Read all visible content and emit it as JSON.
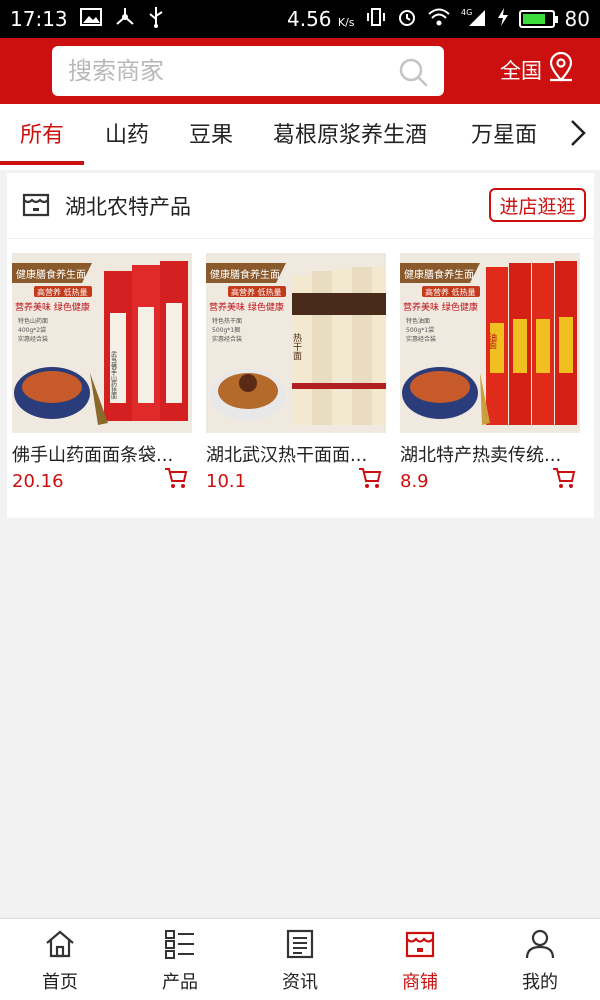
{
  "status_bar": {
    "time": "17:13",
    "net_speed": "4.56",
    "net_unit": "K/s",
    "network": "4G",
    "battery": "80",
    "battery_level": 0.8
  },
  "header": {
    "search_placeholder": "搜索商家",
    "region_label": "全国"
  },
  "tabs": [
    {
      "label": "所有",
      "active": true
    },
    {
      "label": "山药"
    },
    {
      "label": "豆果"
    },
    {
      "label": "葛根原浆养生酒"
    },
    {
      "label": "万星面"
    }
  ],
  "shop": {
    "name": "湖北农特产品",
    "visit_label": "进店逛逛",
    "products": [
      {
        "name": "佛手山药面面条袋...",
        "price": "20.16",
        "banner": "健康膳食养生面",
        "badge": "高营养 低热量",
        "slogan": "营养美味 绿色健康",
        "bullets": [
          "特色山药面",
          "400g*2袋",
          "实惠经合装"
        ],
        "pack_text": "武当佛手山药挂面"
      },
      {
        "name": "湖北武汉热干面面...",
        "price": "10.1",
        "banner": "健康膳食养生面",
        "badge": "高营养 低热量",
        "slogan": "营养美味 绿色健康",
        "bullets": [
          "特色热干面",
          "500g*1捆",
          "实惠经合装"
        ],
        "pack_text": "热干面"
      },
      {
        "name": "湖北特产热卖传统...",
        "price": "8.9",
        "banner": "健康膳食养生面",
        "badge": "高营养 低热量",
        "slogan": "营养美味 绿色健康",
        "bullets": [
          "特色油面",
          "500g*1袋",
          "实惠经合装"
        ],
        "pack_text": "油面"
      }
    ]
  },
  "bottom_nav": [
    {
      "label": "首页",
      "icon": "home-icon"
    },
    {
      "label": "产品",
      "icon": "list-icon"
    },
    {
      "label": "资讯",
      "icon": "news-icon"
    },
    {
      "label": "商铺",
      "icon": "shop-icon",
      "active": true
    },
    {
      "label": "我的",
      "icon": "user-icon"
    }
  ],
  "colors": {
    "brand": "#cc1010",
    "price": "#cc1010"
  }
}
